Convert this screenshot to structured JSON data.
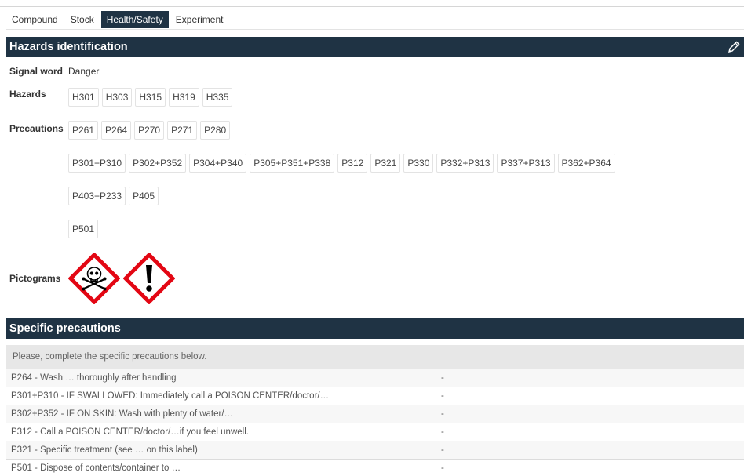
{
  "tabs": [
    {
      "label": "Compound",
      "active": false
    },
    {
      "label": "Stock",
      "active": false
    },
    {
      "label": "Health/Safety",
      "active": true
    },
    {
      "label": "Experiment",
      "active": false
    }
  ],
  "hazards_section": {
    "title": "Hazards identification",
    "edit_icon": "pencil-icon",
    "signal_word_label": "Signal word",
    "signal_word_value": "Danger",
    "hazards_label": "Hazards",
    "hazards": [
      "H301",
      "H303",
      "H315",
      "H319",
      "H335"
    ],
    "precautions_label": "Precautions",
    "precaution_rows": [
      [
        "P261",
        "P264",
        "P270",
        "P271",
        "P280"
      ],
      [
        "P301+P310",
        "P302+P352",
        "P304+P340",
        "P305+P351+P338",
        "P312",
        "P321",
        "P330",
        "P332+P313",
        "P337+P313",
        "P362+P364"
      ],
      [
        "P403+P233",
        "P405"
      ],
      [
        "P501"
      ]
    ],
    "pictograms_label": "Pictograms",
    "pictograms": [
      "skull-crossbones-icon",
      "exclamation-mark-icon"
    ],
    "pictogram_colors": {
      "border": "#e30613",
      "fill": "#ffffff",
      "symbol": "#000000"
    }
  },
  "specific_section": {
    "title": "Specific precautions",
    "notice": "Please, complete the specific precautions below.",
    "rows": [
      {
        "text": "P264 - Wash … thoroughly after handling",
        "value": "-"
      },
      {
        "text": "P301+P310 - IF SWALLOWED: Immediately call a POISON CENTER/doctor/…",
        "value": "-"
      },
      {
        "text": "P302+P352 - IF ON SKIN: Wash with plenty of water/…",
        "value": "-"
      },
      {
        "text": "P312 - Call a POISON CENTER/doctor/…if you feel unwell.",
        "value": "-"
      },
      {
        "text": "P321 - Specific treatment (see … on this label)",
        "value": "-"
      },
      {
        "text": "P501 - Dispose of contents/container to …",
        "value": "-"
      }
    ]
  },
  "colors": {
    "header_bg": "#1f3344",
    "header_text": "#ffffff",
    "notice_bg": "#e7e7e7"
  }
}
